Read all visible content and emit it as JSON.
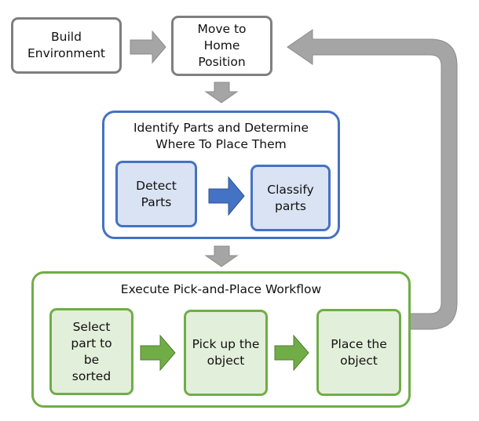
{
  "diagram": {
    "nodes": {
      "build_environment": "Build\nEnvironment",
      "move_home": "Move to\nHome\nPosition",
      "identify_group_title": "Identify Parts and Determine\nWhere To Place Them",
      "detect_parts": "Detect\nParts",
      "classify_parts": "Classify\nparts",
      "execute_group_title": "Execute Pick-and-Place Workflow",
      "select_part": "Select\npart to\nbe\nsorted",
      "pick_up": "Pick up the\nobject",
      "place": "Place the\nobject"
    },
    "edges": [
      {
        "from": "build_environment",
        "to": "move_home",
        "style": "gray-block-arrow"
      },
      {
        "from": "move_home",
        "to": "identify_group",
        "style": "gray-block-arrow"
      },
      {
        "from": "detect_parts",
        "to": "classify_parts",
        "style": "blue-block-arrow"
      },
      {
        "from": "identify_group",
        "to": "execute_group",
        "style": "gray-block-arrow"
      },
      {
        "from": "select_part",
        "to": "pick_up",
        "style": "green-block-arrow"
      },
      {
        "from": "pick_up",
        "to": "place",
        "style": "green-block-arrow"
      },
      {
        "from": "execute_group",
        "to": "move_home",
        "style": "gray-loop-arrow"
      }
    ],
    "colors": {
      "gray_border": "#7f7f7f",
      "gray_arrow": "#a5a5a5",
      "blue": "#4472c4",
      "blue_fill": "#dae3f3",
      "green": "#70ad47",
      "green_fill": "#e2efda"
    }
  }
}
